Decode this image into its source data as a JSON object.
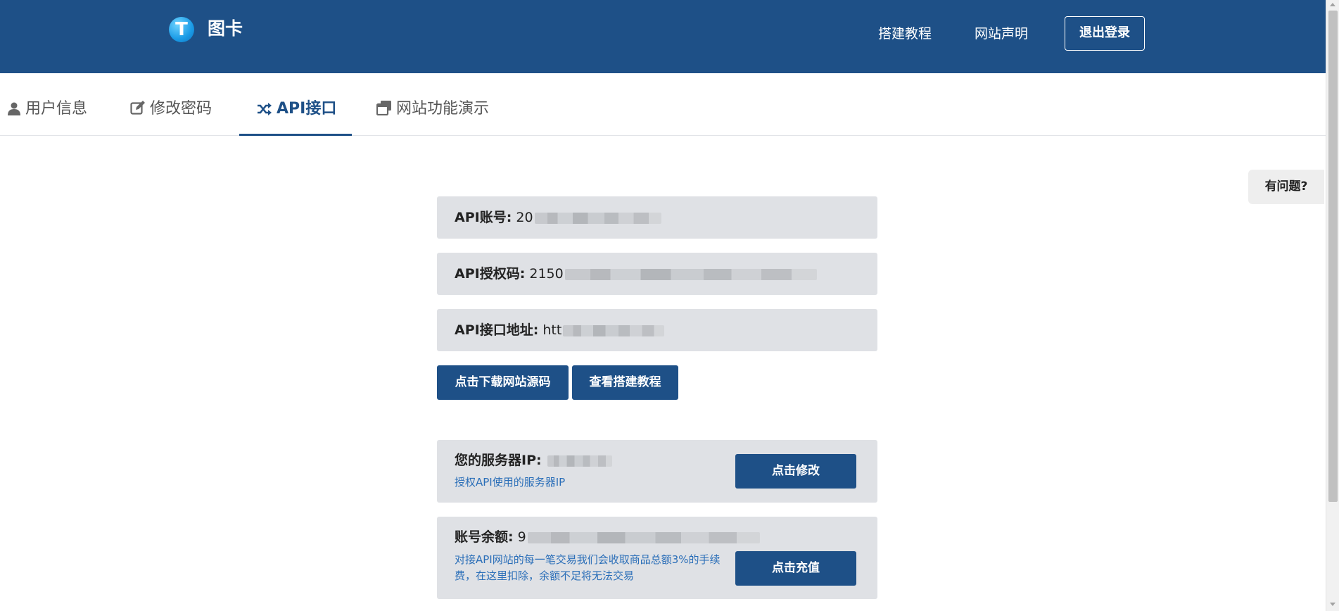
{
  "header": {
    "brand": "图卡",
    "logo_letter": "T",
    "nav": [
      "搭建教程",
      "网站声明"
    ],
    "logout_label": "退出登录"
  },
  "tabs": [
    {
      "label": "用户信息",
      "icon": "user-icon",
      "active": false
    },
    {
      "label": "修改密码",
      "icon": "edit-icon",
      "active": false
    },
    {
      "label": "API接口",
      "icon": "shuffle-icon",
      "active": true
    },
    {
      "label": "网站功能演示",
      "icon": "copy-icon",
      "active": false
    }
  ],
  "help_label": "有问题?",
  "api": {
    "account_label": "API账号:",
    "account_value": "20",
    "auth_label": "API授权码:",
    "auth_value": "2150",
    "url_label": "API接口地址:",
    "url_value": "htt"
  },
  "buttons": {
    "download_source": "点击下载网站源码",
    "view_tutorial": "查看搭建教程"
  },
  "server_ip": {
    "label": "您的服务器IP:",
    "desc": "授权API使用的服务器IP",
    "button": "点击修改"
  },
  "balance": {
    "label": "账号余额:",
    "value": "9",
    "desc": "对接API网站的每一笔交易我们会收取商品总额3%的手续费，在这里扣除，余额不足将无法交易",
    "button": "点击充值"
  },
  "colors": {
    "header_bg": "#1e5087",
    "accent": "#1e5087",
    "box_bg": "#dfe1e5",
    "desc_text": "#2a6eb8"
  }
}
